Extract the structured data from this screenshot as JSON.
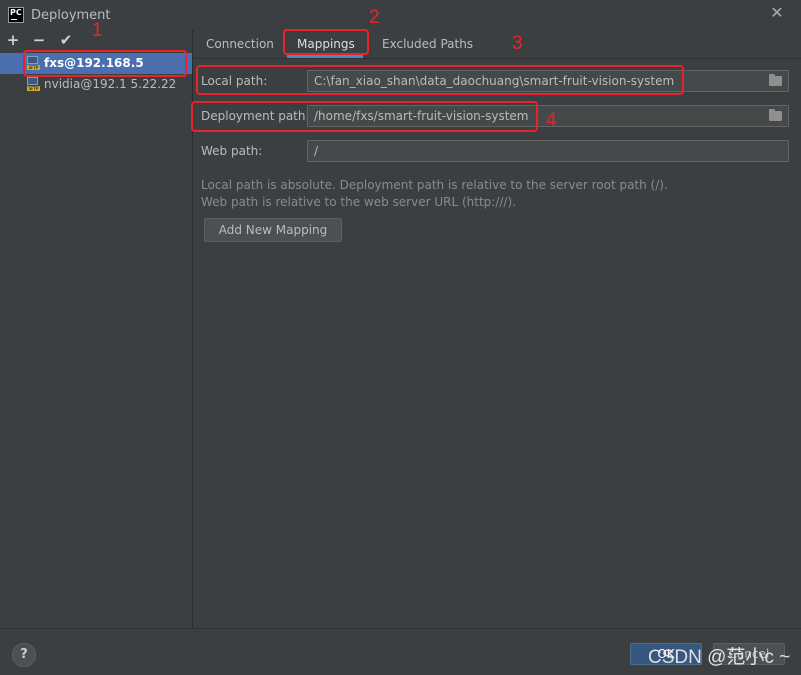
{
  "window": {
    "title": "Deployment",
    "app_icon": "PC"
  },
  "toolbar": {
    "add": "+",
    "remove": "−",
    "apply": "✔"
  },
  "servers": [
    {
      "label": "fxs@192.168.5",
      "type": "SFTP",
      "selected": true
    },
    {
      "label": "nvidia@192.1  5.22.22",
      "type": "SFTP",
      "selected": false
    }
  ],
  "tabs": [
    {
      "label": "Connection"
    },
    {
      "label": "Mappings",
      "active": true
    },
    {
      "label": "Excluded Paths"
    }
  ],
  "fields": {
    "local_label": "Local path:",
    "local_value": "C:\\fan_xiao_shan\\data_daochuang\\smart-fruit-vision-system",
    "deploy_label": "Deployment path:",
    "deploy_value": "/home/fxs/smart-fruit-vision-system",
    "web_label": "Web path:",
    "web_value": "/"
  },
  "info": {
    "line1": "Local path is absolute. Deployment path is relative to the server root path (/).",
    "line2": "Web path is relative to the web server URL (http:///)."
  },
  "buttons": {
    "add_mapping": "Add New Mapping",
    "help": "?",
    "ok": "OK",
    "cancel": "Cancel"
  },
  "annotations": {
    "n1": "1",
    "n2": "2",
    "n3": "3",
    "n4": "4"
  },
  "watermark": "CSDN @范小c ~",
  "colors": {
    "background": "#3c3f41",
    "selection": "#4b6eaf",
    "annotation": "#e8242b",
    "ok_button": "#365880"
  }
}
